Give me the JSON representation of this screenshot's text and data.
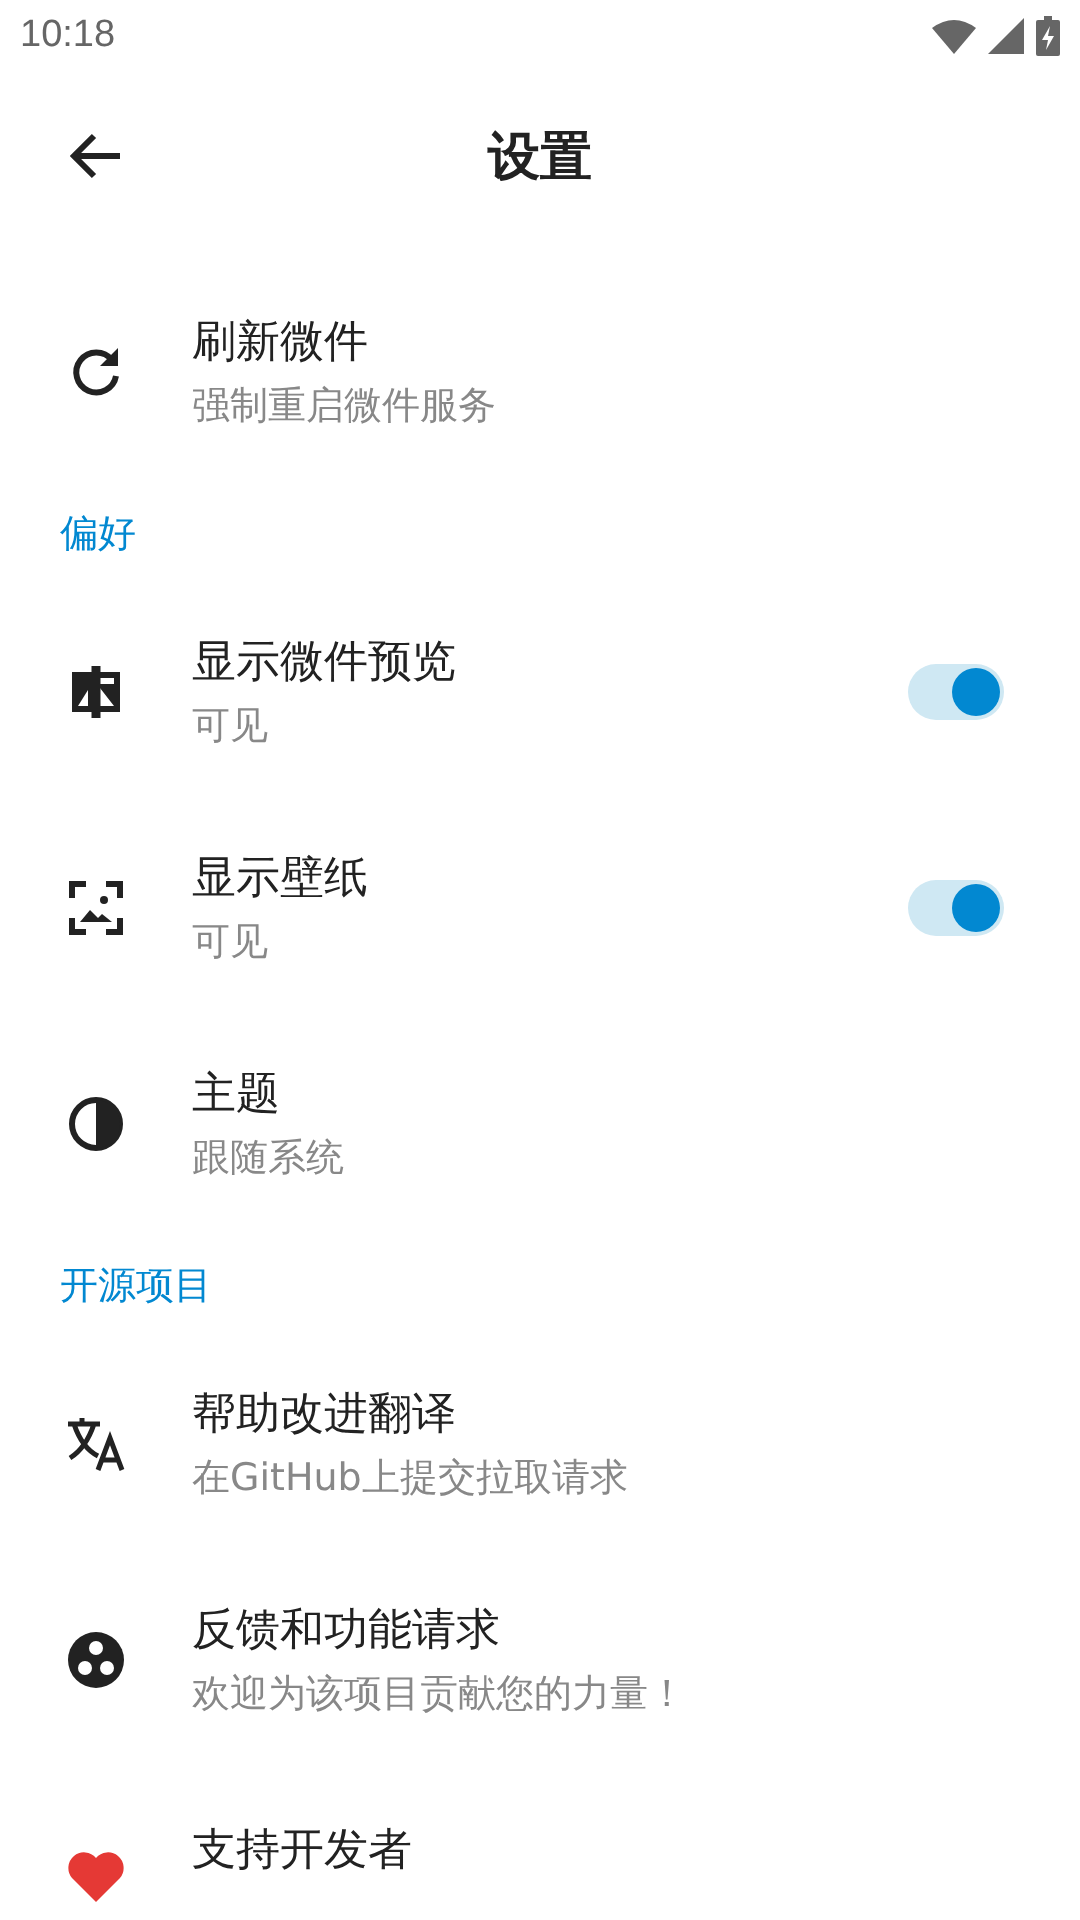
{
  "status_bar": {
    "time": "10:18"
  },
  "toolbar": {
    "title": "设置"
  },
  "sections": [
    {
      "items": [
        {
          "kind": "plain",
          "title": "刷新微件",
          "subtitle": "强制重启微件服务"
        }
      ]
    },
    {
      "header": "偏好",
      "items": [
        {
          "kind": "switch",
          "title": "显示微件预览",
          "subtitle": "可见",
          "on": true
        },
        {
          "kind": "switch",
          "title": "显示壁纸",
          "subtitle": "可见",
          "on": true
        },
        {
          "kind": "plain",
          "title": "主题",
          "subtitle": "跟随系统"
        }
      ]
    },
    {
      "header": "开源项目",
      "items": [
        {
          "kind": "plain",
          "title": "帮助改进翻译",
          "subtitle": "在GitHub上提交拉取请求"
        },
        {
          "kind": "plain",
          "title": "反馈和功能请求",
          "subtitle": "欢迎为该项目贡献您的力量！"
        },
        {
          "kind": "plain",
          "title": "支持开发者"
        }
      ]
    }
  ]
}
